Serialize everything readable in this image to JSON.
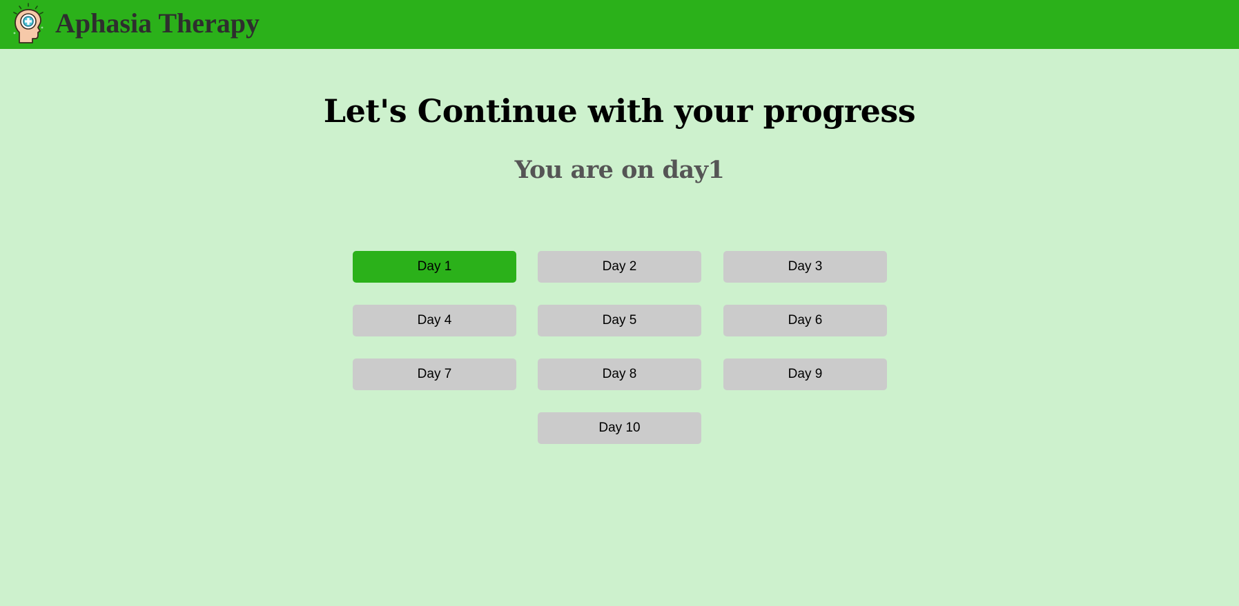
{
  "header": {
    "title": "Aphasia Therapy",
    "logo_icon": "brain-head-icon",
    "background_color": "#2bb11a"
  },
  "main": {
    "headline": "Let's Continue with your progress",
    "subheadline": "You are on day1"
  },
  "days": {
    "active_color": "#2bb11a",
    "inactive_color": "#cbcbcb",
    "items": [
      {
        "label": "Day 1",
        "active": true
      },
      {
        "label": "Day 2",
        "active": false
      },
      {
        "label": "Day 3",
        "active": false
      },
      {
        "label": "Day 4",
        "active": false
      },
      {
        "label": "Day 5",
        "active": false
      },
      {
        "label": "Day 6",
        "active": false
      },
      {
        "label": "Day 7",
        "active": false
      },
      {
        "label": "Day 8",
        "active": false
      },
      {
        "label": "Day 9",
        "active": false
      },
      {
        "label": "Day 10",
        "active": false
      }
    ]
  }
}
